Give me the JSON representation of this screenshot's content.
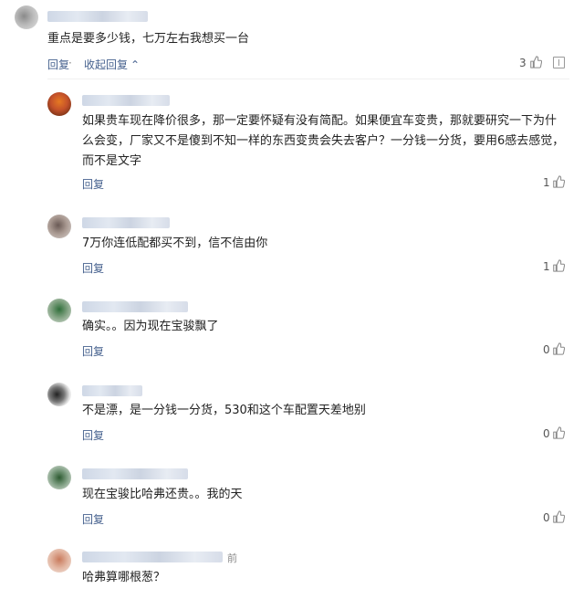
{
  "top_comment": {
    "text": "重点是要多少钱，七万左右我想买一台",
    "reply_label": "回复",
    "sep": " · ",
    "collapse_label": "收起回复",
    "collapse_arrow": "⌃",
    "like_count": "3"
  },
  "replies": [
    {
      "text": "如果贵车现在降价很多，那一定要怀疑有没有简配。如果便宜车变贵，那就要研究一下为什么会变，厂家又不是傻到不知一样的东西变贵会失去客户？一分钱一分货，要用6感去感觉，而不是文字",
      "reply_label": "回复",
      "like_count": "1"
    },
    {
      "text": "7万你连低配都买不到，信不信由你",
      "reply_label": "回复",
      "like_count": "1"
    },
    {
      "text": "确实。。因为现在宝骏飘了",
      "reply_label": "回复",
      "like_count": "0"
    },
    {
      "text": "不是漂，是一分钱一分货，530和这个车配置天差地别",
      "reply_label": "回复",
      "like_count": "0"
    },
    {
      "text": "现在宝骏比哈弗还贵。。我的天",
      "reply_label": "回复",
      "like_count": "0"
    },
    {
      "text": "哈弗算哪根葱？",
      "time_suffix": "前"
    }
  ],
  "icons": {
    "like": "thumbs-up-icon",
    "report": "flag-icon"
  }
}
